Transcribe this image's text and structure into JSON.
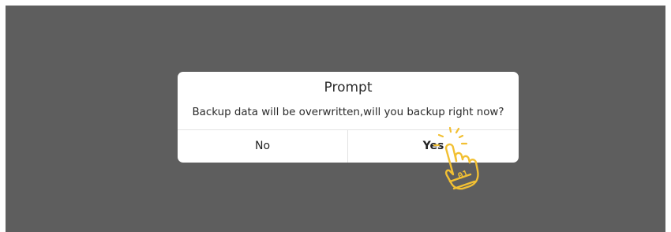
{
  "dialog": {
    "title": "Prompt",
    "message": "Backup data will be overwritten,will you backup right now?",
    "no_label": "No",
    "yes_label": "Yes"
  },
  "pointer": {
    "icon": "tap-hand-icon",
    "color": "#f2c033"
  },
  "colors": {
    "overlay": "#5e5e5e",
    "dialog_bg": "#ffffff"
  }
}
